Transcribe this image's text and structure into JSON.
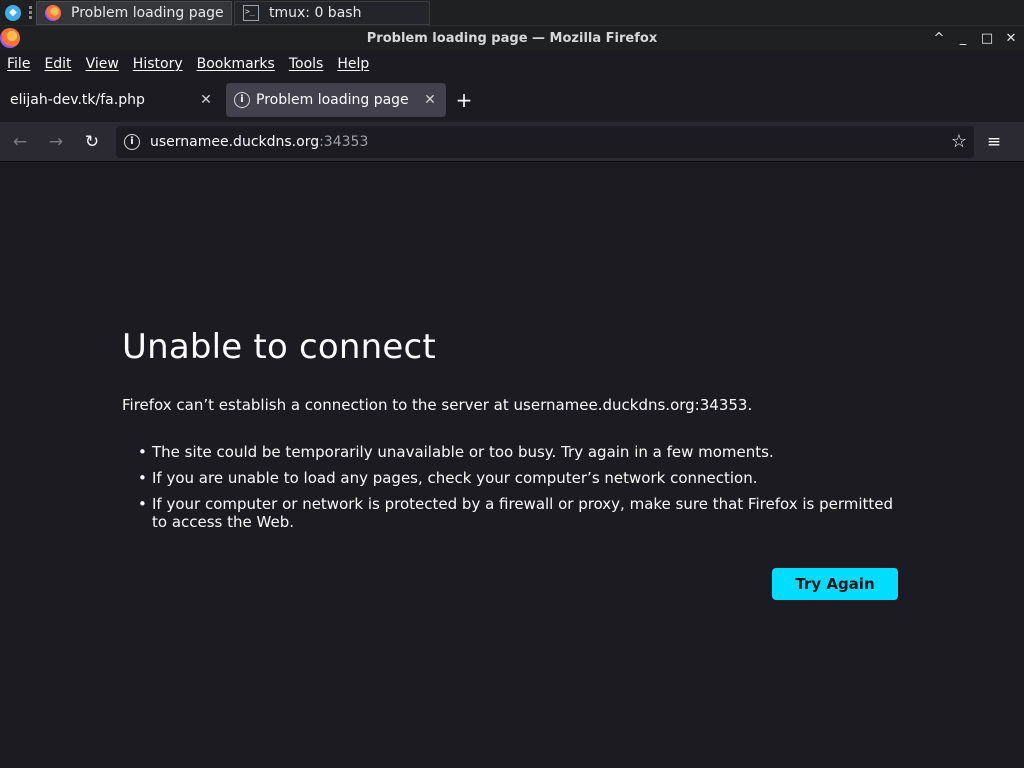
{
  "taskbar": {
    "launcher_icon": "kde-launcher-icon",
    "tasks": [
      {
        "label": "Problem loading page ...",
        "icon": "firefox-icon",
        "active": true
      },
      {
        "label": "tmux: 0 bash",
        "icon": "terminal-icon",
        "active": false
      }
    ]
  },
  "window": {
    "title": "Problem loading page — Mozilla Firefox",
    "buttons": {
      "keep_above": "^",
      "minimize": "_",
      "maximize": "□",
      "close": "✕"
    }
  },
  "menubar": {
    "items": [
      "File",
      "Edit",
      "View",
      "History",
      "Bookmarks",
      "Tools",
      "Help"
    ]
  },
  "tabs": [
    {
      "label": "elijah-dev.tk/fa.php",
      "active": false
    },
    {
      "label": "Problem loading page",
      "active": true
    }
  ],
  "toolbar": {
    "back": "←",
    "forward": "→",
    "reload": "↻",
    "url_host": "usernamee.duckdns.org",
    "url_port": ":34353",
    "bookmark_star": "☆",
    "app_menu": "≡",
    "new_tab": "+"
  },
  "error": {
    "title": "Unable to connect",
    "description": "Firefox can’t establish a connection to the server at usernamee.duckdns.org:34353.",
    "bullets": [
      "The site could be temporarily unavailable or too busy. Try again in a few moments.",
      "If you are unable to load any pages, check your computer’s network connection.",
      "If your computer or network is protected by a firewall or proxy, make sure that Firefox is permitted to access the Web."
    ],
    "button_label": "Try Again"
  },
  "colors": {
    "accent": "#00ddff",
    "page_bg": "#1c1b22",
    "toolbar_bg": "#2b2a33",
    "active_tab_bg": "#42414d"
  }
}
